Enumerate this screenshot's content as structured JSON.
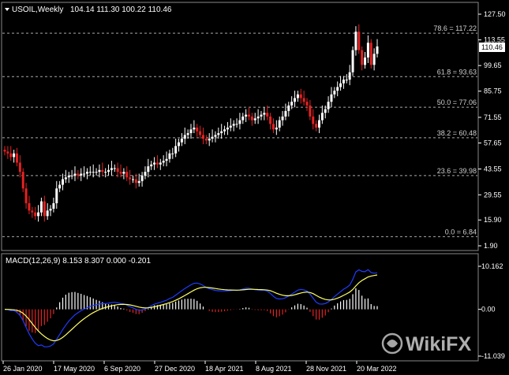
{
  "symbol_title": "USOIL,Weekly",
  "ohlc": "104.14 111.30 100.22 110.46",
  "current_price_label": "110.46",
  "macd_title": "MACD(12,26,9) 8.153 8.307 0.000 -0.201",
  "watermark": "WikiFX",
  "colors": {
    "background": "#000000",
    "bull": "#ffffff",
    "bear": "#e52222",
    "macd_line": "#1e3cff",
    "signal_line": "#ffff66",
    "grid": "#aaaaaa"
  },
  "chart_data": [
    {
      "type": "candlestick",
      "title": "USOIL,Weekly",
      "price_axis_ticks": [
        "127.50",
        "113.55",
        "99.65",
        "85.75",
        "71.55",
        "57.65",
        "43.55",
        "29.55",
        "15.90",
        "1.90"
      ],
      "ylim": [
        1.9,
        127.5
      ],
      "fib_levels": [
        {
          "label": "78.6 = 117.22",
          "value": 117.22
        },
        {
          "label": "61.8 = 93.63",
          "value": 93.63
        },
        {
          "label": "50.0 = 77.06",
          "value": 77.06
        },
        {
          "label": "38.2 = 60.48",
          "value": 60.48
        },
        {
          "label": "23.6 = 39.98",
          "value": 39.98
        },
        {
          "label": "0.0 = 6.84",
          "value": 6.84
        }
      ],
      "date_labels": [
        "26 Jan 2020",
        "17 May 2020",
        "6 Sep 2020",
        "27 Dec 2020",
        "18 Apr 2021",
        "8 Aug 2021",
        "28 Nov 2021",
        "20 Mar 2022"
      ],
      "close_series": [
        53,
        52,
        50,
        52,
        47,
        42,
        33,
        25,
        21,
        20,
        18,
        20,
        26,
        18,
        21,
        22,
        25,
        33,
        35,
        38,
        39,
        40,
        40,
        41,
        40,
        41,
        41,
        42,
        42,
        42,
        42,
        43,
        42,
        42,
        43,
        44,
        44,
        42,
        41,
        42,
        39,
        38,
        38,
        36,
        37,
        40,
        42,
        45,
        46,
        47,
        46,
        47,
        48,
        49,
        52,
        52,
        56,
        58,
        60,
        62,
        63,
        65,
        66,
        64,
        62,
        60,
        59,
        60,
        61,
        62,
        63,
        64,
        65,
        66,
        67,
        68,
        68,
        70,
        72,
        73,
        72,
        70,
        71,
        72,
        73,
        74,
        72,
        68,
        65,
        66,
        70,
        72,
        75,
        78,
        80,
        82,
        84,
        82,
        80,
        78,
        72,
        68,
        66,
        70,
        74,
        76,
        80,
        84,
        86,
        88,
        90,
        92,
        92,
        96,
        108,
        118,
        108,
        100,
        104,
        112,
        100,
        106,
        110
      ]
    },
    {
      "type": "macd",
      "title": "MACD(12,26,9) 8.153 8.307 0.000 -0.201",
      "params": "12,26,9",
      "main": 8.153,
      "signal": 8.307,
      "axis_ticks": [
        "10.162",
        "0.00",
        "-11.039"
      ],
      "ylim": [
        -11.039,
        10.162
      ]
    }
  ]
}
